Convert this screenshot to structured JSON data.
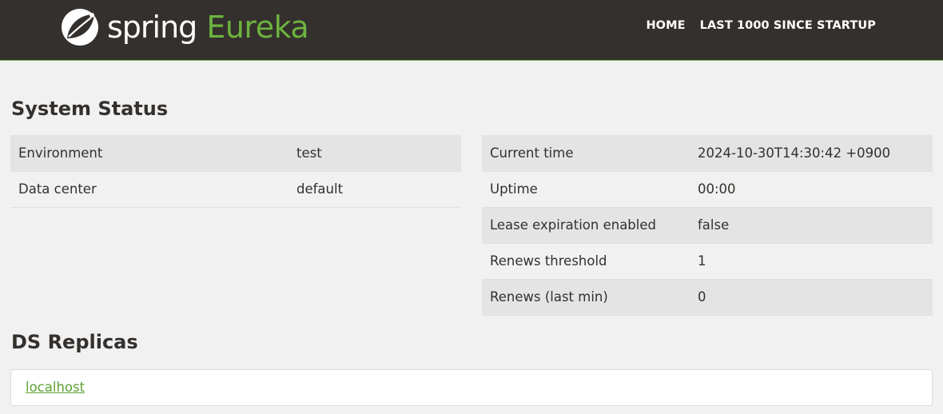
{
  "brand": {
    "spring": "spring",
    "eureka": "Eureka",
    "icon": "spring-leaf-logo",
    "accent_color": "#6db33f"
  },
  "nav": {
    "home": "HOME",
    "last1000": "LAST 1000 SINCE STARTUP"
  },
  "system_status": {
    "title": "System Status",
    "left_rows": [
      {
        "key": "Environment",
        "value": "test"
      },
      {
        "key": "Data center",
        "value": "default"
      }
    ],
    "right_rows": [
      {
        "key": "Current time",
        "value": "2024-10-30T14:30:42 +0900"
      },
      {
        "key": "Uptime",
        "value": "00:00"
      },
      {
        "key": "Lease expiration enabled",
        "value": "false"
      },
      {
        "key": "Renews threshold",
        "value": "1"
      },
      {
        "key": "Renews (last min)",
        "value": "0"
      }
    ]
  },
  "ds_replicas": {
    "title": "DS Replicas",
    "items": [
      "localhost"
    ]
  }
}
